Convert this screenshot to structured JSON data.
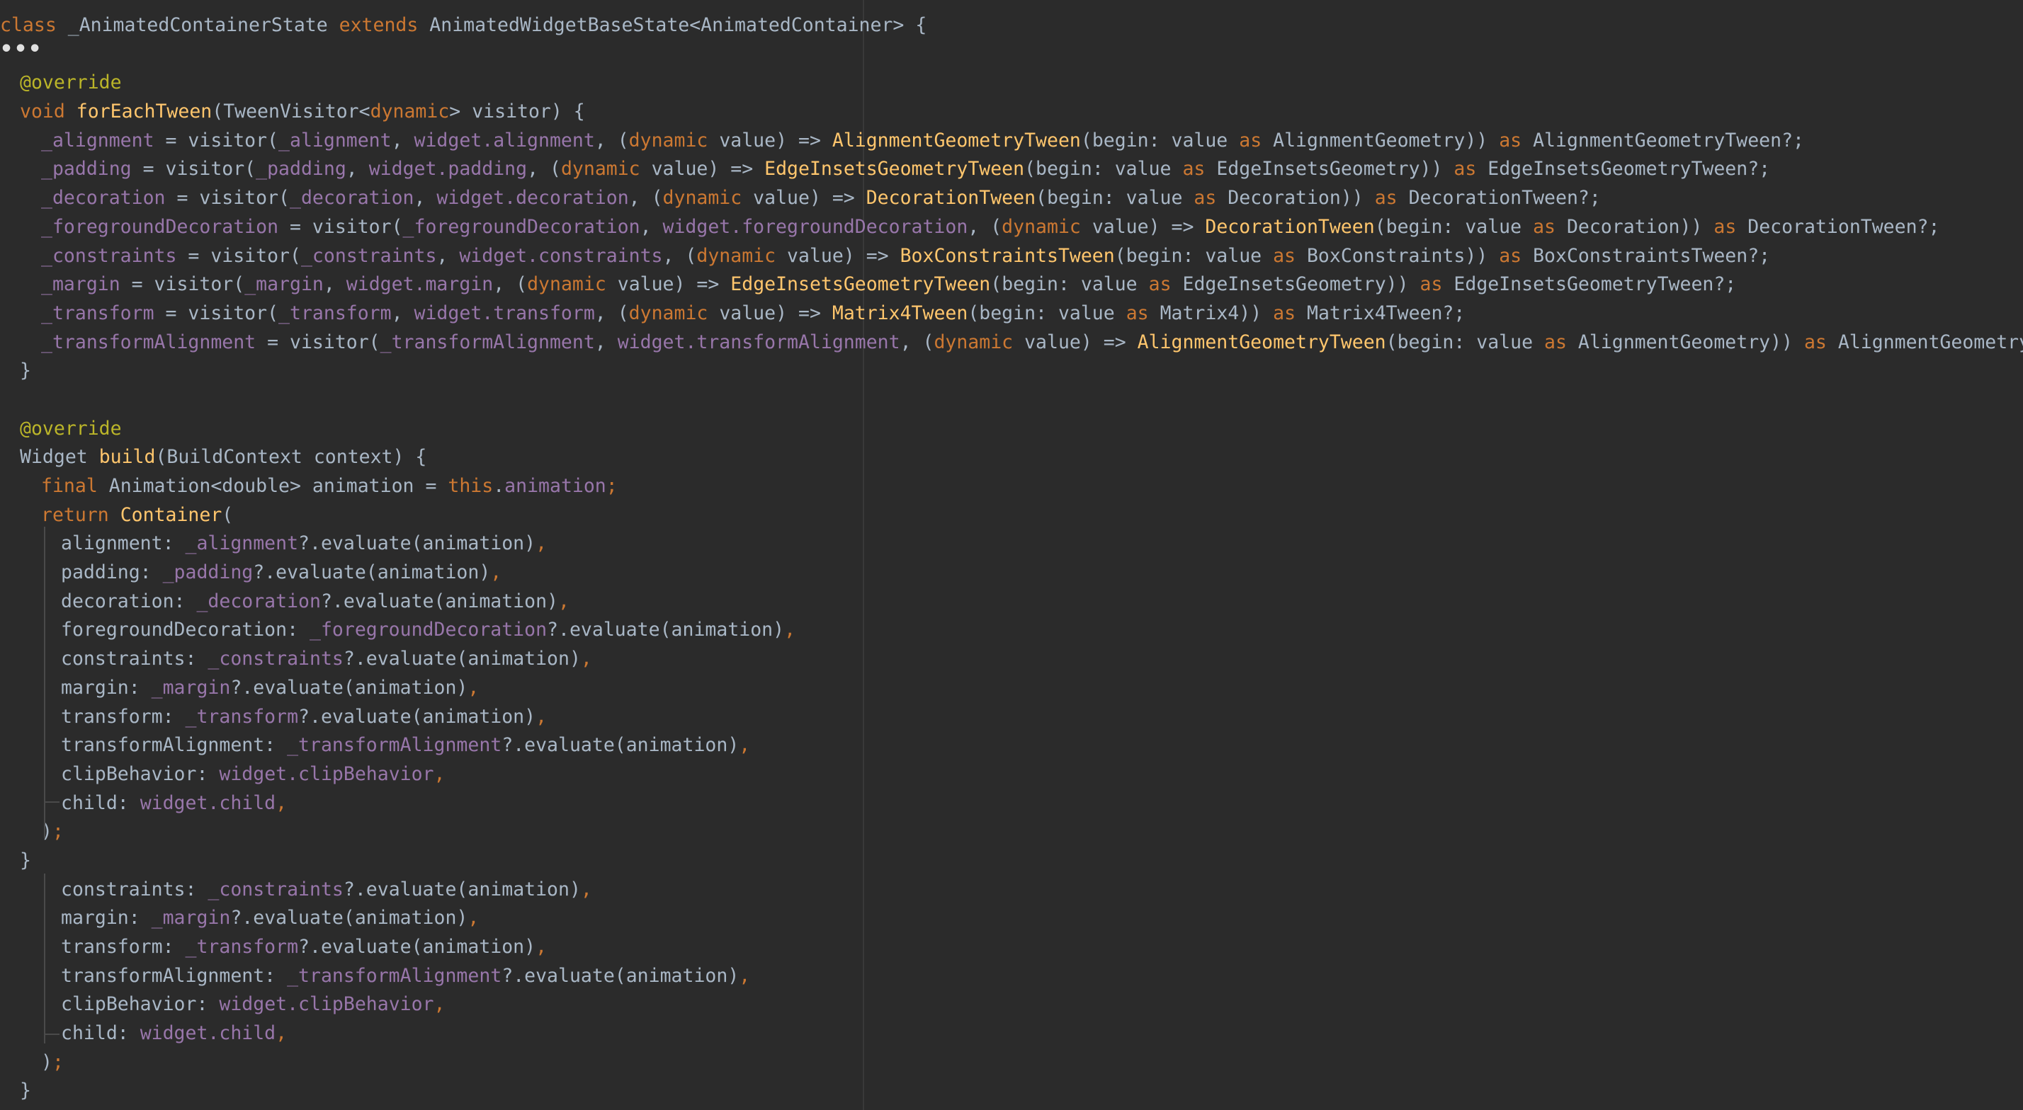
{
  "editor": {
    "language": "dart",
    "colors": {
      "background": "#2b2b2b",
      "plain": "#a9b7c6",
      "keyword": "#cc7832",
      "annotation": "#bbb529",
      "function": "#ffc66d",
      "field": "#9876aa",
      "guide": "#4a4a4a"
    },
    "fold_marker": "•••",
    "lines": [
      {
        "indent": 0,
        "tokens": [
          [
            "k",
            "class "
          ],
          [
            "t",
            "_AnimatedContainerState "
          ],
          [
            "k",
            "extends "
          ],
          [
            "t",
            "AnimatedWidgetBaseState<AnimatedContainer> {"
          ]
        ]
      },
      {
        "indent": 0,
        "fold": true,
        "tokens": []
      },
      {
        "indent": 1,
        "tokens": [
          [
            "a",
            "@override"
          ]
        ]
      },
      {
        "indent": 1,
        "tokens": [
          [
            "k",
            "void "
          ],
          [
            "f",
            "forEachTween"
          ],
          [
            "t",
            "(TweenVisitor<"
          ],
          [
            "k",
            "dynamic"
          ],
          [
            "t",
            "> visitor) {"
          ]
        ]
      },
      {
        "indent": 2,
        "tokens": [
          [
            "p",
            "_alignment"
          ],
          [
            "t",
            " = visitor("
          ],
          [
            "p",
            "_alignment"
          ],
          [
            "t",
            ", "
          ],
          [
            "p",
            "widget.alignment"
          ],
          [
            "t",
            ", ("
          ],
          [
            "k",
            "dynamic "
          ],
          [
            "t",
            "value) => "
          ],
          [
            "f",
            "AlignmentGeometryTween"
          ],
          [
            "t",
            "(begin: value "
          ],
          [
            "k",
            "as "
          ],
          [
            "t",
            "AlignmentGeometry)) "
          ],
          [
            "k",
            "as "
          ],
          [
            "t",
            "AlignmentGeometryTween?;"
          ]
        ]
      },
      {
        "indent": 2,
        "tokens": [
          [
            "p",
            "_padding"
          ],
          [
            "t",
            " = visitor("
          ],
          [
            "p",
            "_padding"
          ],
          [
            "t",
            ", "
          ],
          [
            "p",
            "widget.padding"
          ],
          [
            "t",
            ", ("
          ],
          [
            "k",
            "dynamic "
          ],
          [
            "t",
            "value) => "
          ],
          [
            "f",
            "EdgeInsetsGeometryTween"
          ],
          [
            "t",
            "(begin: value "
          ],
          [
            "k",
            "as "
          ],
          [
            "t",
            "EdgeInsetsGeometry)) "
          ],
          [
            "k",
            "as "
          ],
          [
            "t",
            "EdgeInsetsGeometryTween?;"
          ]
        ]
      },
      {
        "indent": 2,
        "tokens": [
          [
            "p",
            "_decoration"
          ],
          [
            "t",
            " = visitor("
          ],
          [
            "p",
            "_decoration"
          ],
          [
            "t",
            ", "
          ],
          [
            "p",
            "widget.decoration"
          ],
          [
            "t",
            ", ("
          ],
          [
            "k",
            "dynamic "
          ],
          [
            "t",
            "value) => "
          ],
          [
            "f",
            "DecorationTween"
          ],
          [
            "t",
            "(begin: value "
          ],
          [
            "k",
            "as "
          ],
          [
            "t",
            "Decoration)) "
          ],
          [
            "k",
            "as "
          ],
          [
            "t",
            "DecorationTween?;"
          ]
        ]
      },
      {
        "indent": 2,
        "tokens": [
          [
            "p",
            "_foregroundDecoration"
          ],
          [
            "t",
            " = visitor("
          ],
          [
            "p",
            "_foregroundDecoration"
          ],
          [
            "t",
            ", "
          ],
          [
            "p",
            "widget.foregroundDecoration"
          ],
          [
            "t",
            ", ("
          ],
          [
            "k",
            "dynamic "
          ],
          [
            "t",
            "value) => "
          ],
          [
            "f",
            "DecorationTween"
          ],
          [
            "t",
            "(begin: value "
          ],
          [
            "k",
            "as "
          ],
          [
            "t",
            "Decoration)) "
          ],
          [
            "k",
            "as "
          ],
          [
            "t",
            "DecorationTween?;"
          ]
        ]
      },
      {
        "indent": 2,
        "tokens": [
          [
            "p",
            "_constraints"
          ],
          [
            "t",
            " = visitor("
          ],
          [
            "p",
            "_constraints"
          ],
          [
            "t",
            ", "
          ],
          [
            "p",
            "widget.constraints"
          ],
          [
            "t",
            ", ("
          ],
          [
            "k",
            "dynamic "
          ],
          [
            "t",
            "value) => "
          ],
          [
            "f",
            "BoxConstraintsTween"
          ],
          [
            "t",
            "(begin: value "
          ],
          [
            "k",
            "as "
          ],
          [
            "t",
            "BoxConstraints)) "
          ],
          [
            "k",
            "as "
          ],
          [
            "t",
            "BoxConstraintsTween?;"
          ]
        ]
      },
      {
        "indent": 2,
        "tokens": [
          [
            "p",
            "_margin"
          ],
          [
            "t",
            " = visitor("
          ],
          [
            "p",
            "_margin"
          ],
          [
            "t",
            ", "
          ],
          [
            "p",
            "widget.margin"
          ],
          [
            "t",
            ", ("
          ],
          [
            "k",
            "dynamic "
          ],
          [
            "t",
            "value) => "
          ],
          [
            "f",
            "EdgeInsetsGeometryTween"
          ],
          [
            "t",
            "(begin: value "
          ],
          [
            "k",
            "as "
          ],
          [
            "t",
            "EdgeInsetsGeometry)) "
          ],
          [
            "k",
            "as "
          ],
          [
            "t",
            "EdgeInsetsGeometryTween?;"
          ]
        ]
      },
      {
        "indent": 2,
        "tokens": [
          [
            "p",
            "_transform"
          ],
          [
            "t",
            " = visitor("
          ],
          [
            "p",
            "_transform"
          ],
          [
            "t",
            ", "
          ],
          [
            "p",
            "widget.transform"
          ],
          [
            "t",
            ", ("
          ],
          [
            "k",
            "dynamic "
          ],
          [
            "t",
            "value) => "
          ],
          [
            "f",
            "Matrix4Tween"
          ],
          [
            "t",
            "(begin: value "
          ],
          [
            "k",
            "as "
          ],
          [
            "t",
            "Matrix4)) "
          ],
          [
            "k",
            "as "
          ],
          [
            "t",
            "Matrix4Tween?;"
          ]
        ]
      },
      {
        "indent": 2,
        "tokens": [
          [
            "p",
            "_transformAlignment"
          ],
          [
            "t",
            " = visitor("
          ],
          [
            "p",
            "_transformAlignment"
          ],
          [
            "t",
            ", "
          ],
          [
            "p",
            "widget.transformAlignment"
          ],
          [
            "t",
            ", ("
          ],
          [
            "k",
            "dynamic "
          ],
          [
            "t",
            "value) => "
          ],
          [
            "f",
            "AlignmentGeometryTween"
          ],
          [
            "t",
            "(begin: value "
          ],
          [
            "k",
            "as "
          ],
          [
            "t",
            "AlignmentGeometry)) "
          ],
          [
            "k",
            "as "
          ],
          [
            "t",
            "AlignmentGeometryTween?;"
          ]
        ]
      },
      {
        "indent": 1,
        "tokens": [
          [
            "t",
            "}"
          ]
        ]
      },
      {
        "indent": 0,
        "tokens": []
      },
      {
        "indent": 1,
        "tokens": [
          [
            "a",
            "@override"
          ]
        ]
      },
      {
        "indent": 1,
        "tokens": [
          [
            "t",
            "Widget "
          ],
          [
            "f",
            "build"
          ],
          [
            "t",
            "(BuildContext context) {"
          ]
        ]
      },
      {
        "indent": 2,
        "tokens": [
          [
            "k",
            "final "
          ],
          [
            "t",
            "Animation<double> animation = "
          ],
          [
            "k",
            "this"
          ],
          [
            "t",
            "."
          ],
          [
            "p",
            "animation"
          ],
          [
            "k",
            ";"
          ]
        ]
      },
      {
        "indent": 2,
        "tokens": [
          [
            "k",
            "return "
          ],
          [
            "f",
            "Container"
          ],
          [
            "t",
            "("
          ]
        ]
      },
      {
        "indent": 3,
        "tokens": [
          [
            "t",
            "alignment: "
          ],
          [
            "p",
            "_alignment"
          ],
          [
            "t",
            "?.evaluate(animation)"
          ],
          [
            "k",
            ","
          ]
        ]
      },
      {
        "indent": 3,
        "tokens": [
          [
            "t",
            "padding: "
          ],
          [
            "p",
            "_padding"
          ],
          [
            "t",
            "?.evaluate(animation)"
          ],
          [
            "k",
            ","
          ]
        ]
      },
      {
        "indent": 3,
        "tokens": [
          [
            "t",
            "decoration: "
          ],
          [
            "p",
            "_decoration"
          ],
          [
            "t",
            "?.evaluate(animation)"
          ],
          [
            "k",
            ","
          ]
        ]
      },
      {
        "indent": 3,
        "tokens": [
          [
            "t",
            "foregroundDecoration: "
          ],
          [
            "p",
            "_foregroundDecoration"
          ],
          [
            "t",
            "?.evaluate(animation)"
          ],
          [
            "k",
            ","
          ]
        ]
      },
      {
        "indent": 3,
        "tokens": [
          [
            "t",
            "constraints: "
          ],
          [
            "p",
            "_constraints"
          ],
          [
            "t",
            "?.evaluate(animation)"
          ],
          [
            "k",
            ","
          ]
        ]
      },
      {
        "indent": 3,
        "tokens": [
          [
            "t",
            "margin: "
          ],
          [
            "p",
            "_margin"
          ],
          [
            "t",
            "?.evaluate(animation)"
          ],
          [
            "k",
            ","
          ]
        ]
      },
      {
        "indent": 3,
        "tokens": [
          [
            "t",
            "transform: "
          ],
          [
            "p",
            "_transform"
          ],
          [
            "t",
            "?.evaluate(animation)"
          ],
          [
            "k",
            ","
          ]
        ]
      },
      {
        "indent": 3,
        "tokens": [
          [
            "t",
            "transformAlignment: "
          ],
          [
            "p",
            "_transformAlignment"
          ],
          [
            "t",
            "?.evaluate(animation)"
          ],
          [
            "k",
            ","
          ]
        ]
      },
      {
        "indent": 3,
        "tokens": [
          [
            "t",
            "clipBehavior: "
          ],
          [
            "p",
            "widget.clipBehavior"
          ],
          [
            "k",
            ","
          ]
        ]
      },
      {
        "indent": 3,
        "tokens": [
          [
            "t",
            "child: "
          ],
          [
            "p",
            "widget.child"
          ],
          [
            "k",
            ","
          ]
        ]
      },
      {
        "indent": 2,
        "tokens": [
          [
            "t",
            ")"
          ],
          [
            "k",
            ";"
          ]
        ]
      },
      {
        "indent": 1,
        "tokens": [
          [
            "t",
            "}"
          ]
        ]
      },
      {
        "indent": 3,
        "tokens": [
          [
            "t",
            "constraints: "
          ],
          [
            "p",
            "_constraints"
          ],
          [
            "t",
            "?.evaluate(animation)"
          ],
          [
            "k",
            ","
          ]
        ]
      },
      {
        "indent": 3,
        "tokens": [
          [
            "t",
            "margin: "
          ],
          [
            "p",
            "_margin"
          ],
          [
            "t",
            "?.evaluate(animation)"
          ],
          [
            "k",
            ","
          ]
        ]
      },
      {
        "indent": 3,
        "tokens": [
          [
            "t",
            "transform: "
          ],
          [
            "p",
            "_transform"
          ],
          [
            "t",
            "?.evaluate(animation)"
          ],
          [
            "k",
            ","
          ]
        ]
      },
      {
        "indent": 3,
        "tokens": [
          [
            "t",
            "transformAlignment: "
          ],
          [
            "p",
            "_transformAlignment"
          ],
          [
            "t",
            "?.evaluate(animation)"
          ],
          [
            "k",
            ","
          ]
        ]
      },
      {
        "indent": 3,
        "tokens": [
          [
            "t",
            "clipBehavior: "
          ],
          [
            "p",
            "widget.clipBehavior"
          ],
          [
            "k",
            ","
          ]
        ]
      },
      {
        "indent": 3,
        "tokens": [
          [
            "t",
            "child: "
          ],
          [
            "p",
            "widget.child"
          ],
          [
            "k",
            ","
          ]
        ]
      },
      {
        "indent": 2,
        "tokens": [
          [
            "t",
            ")"
          ],
          [
            "k",
            ";"
          ]
        ]
      },
      {
        "indent": 1,
        "tokens": [
          [
            "t",
            "}"
          ]
        ]
      }
    ]
  }
}
